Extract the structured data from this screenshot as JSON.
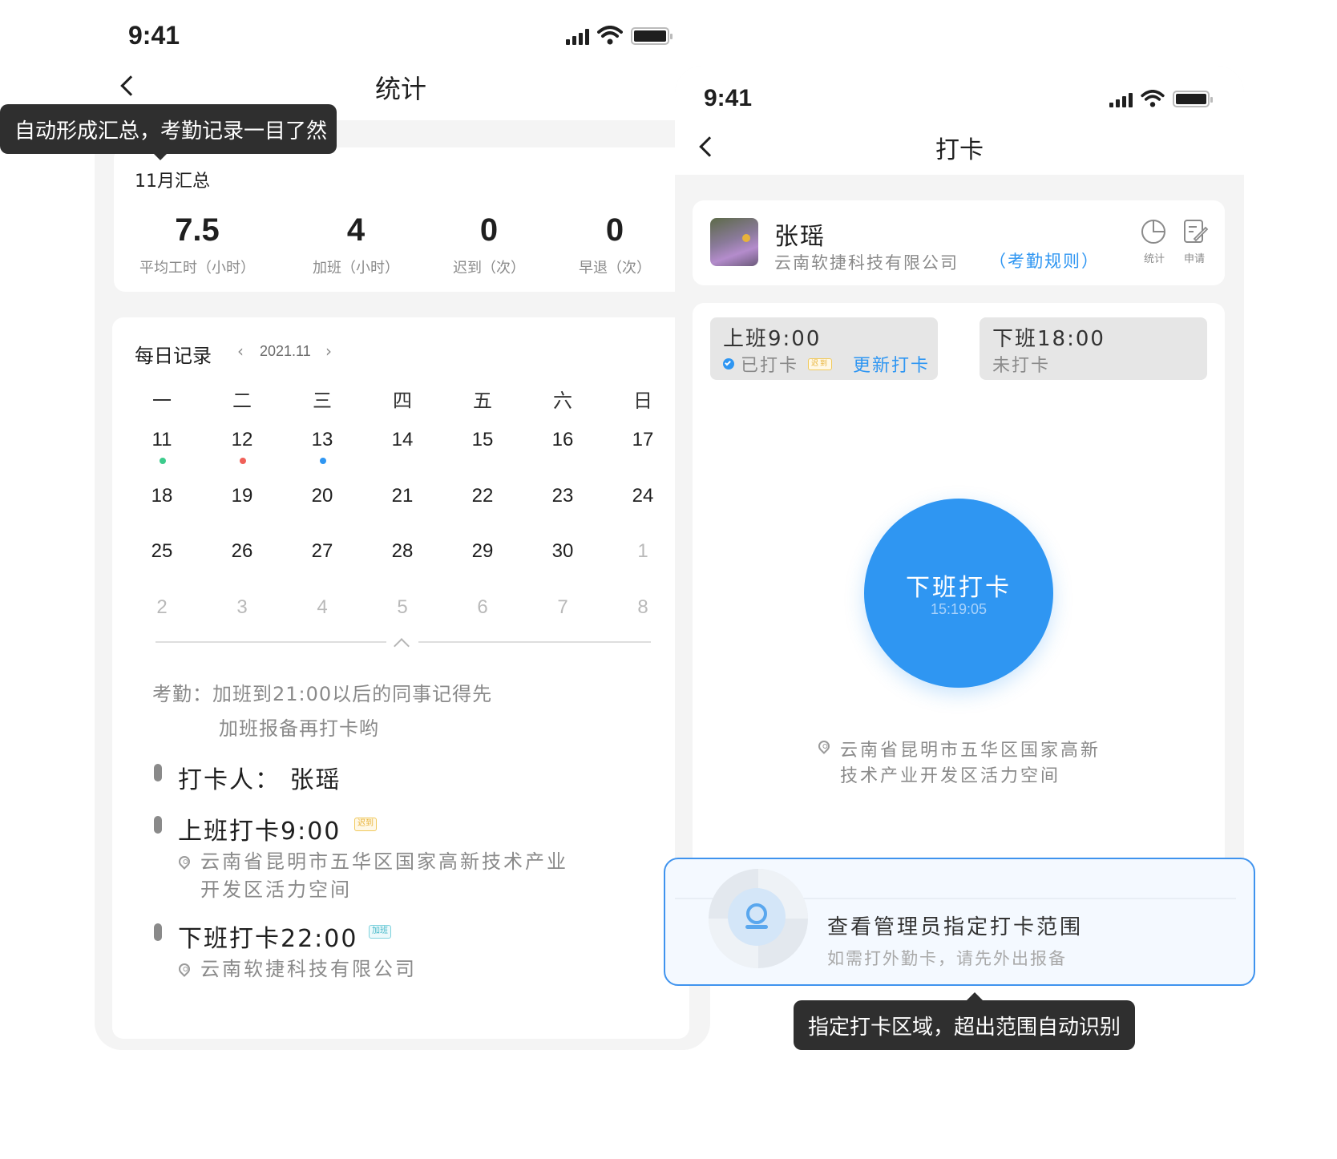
{
  "left": {
    "status": {
      "time": "9:41"
    },
    "nav": {
      "title": "统计"
    },
    "tooltip": "自动形成汇总，考勤记录一目了然",
    "summary": {
      "title": "11月汇总",
      "items": [
        {
          "value": "7.5",
          "label": "平均工时（小时）"
        },
        {
          "value": "4",
          "label": "加班（小时）"
        },
        {
          "value": "0",
          "label": "迟到（次）"
        },
        {
          "value": "0",
          "label": "早退（次）"
        }
      ]
    },
    "daily": {
      "title": "每日记录",
      "prev": "‹",
      "month": "2021.11",
      "next": "›",
      "weekdays": [
        "一",
        "二",
        "三",
        "四",
        "五",
        "六",
        "日"
      ],
      "weeks": [
        [
          "11",
          "12",
          "13",
          "14",
          "15",
          "16",
          "17"
        ],
        [
          "18",
          "19",
          "20",
          "21",
          "22",
          "23",
          "24"
        ],
        [
          "25",
          "26",
          "27",
          "28",
          "29",
          "30",
          "1"
        ],
        [
          "2",
          "3",
          "4",
          "5",
          "6",
          "7",
          "8"
        ]
      ],
      "collapse_icon": "chevron-up-icon"
    },
    "notice": {
      "line1": "考勤：加班到21:00以后的同事记得先",
      "line2": "加班报备再打卡哟"
    },
    "records": {
      "person": "打卡人： 张瑶",
      "clock_in": {
        "title": "上班打卡9:00",
        "tag": "迟到",
        "address1": "云南省昆明市五华区国家高新技术产业",
        "address2": "开发区活力空间"
      },
      "clock_out": {
        "title": "下班打卡22:00",
        "tag": "加班",
        "address": "云南软捷科技有限公司"
      }
    }
  },
  "right": {
    "status": {
      "time": "9:41"
    },
    "nav": {
      "title": "打卡"
    },
    "profile": {
      "name": "张瑶",
      "company": "云南软捷科技有限公司",
      "rules_link": "（考勤规则）",
      "stats_label": "统计",
      "apply_label": "申请"
    },
    "shifts": {
      "on": {
        "title": "上班9:00",
        "status": "已打卡",
        "tag": "迟到",
        "update": "更新打卡"
      },
      "off": {
        "title": "下班18:00",
        "status": "未打卡"
      }
    },
    "clock_button": {
      "label": "下班打卡",
      "time": "15:19:05"
    },
    "location": {
      "line1": "云南省昆明市五华区国家高新",
      "line2": "技术产业开发区活力空间"
    },
    "range": {
      "title": "查看管理员指定打卡范围",
      "subtitle": "如需打外勤卡，请先外出报备"
    },
    "tooltip": "指定打卡区域，超出范围自动识别"
  },
  "colors": {
    "primary": "#2F96F2",
    "late": "#E8B33A",
    "overtime": "#43B8C8",
    "dot_green": "#3CCB8C",
    "dot_red": "#F06058",
    "dot_blue": "#2F96F2",
    "tooltip_bg": "#2F2F2F"
  }
}
